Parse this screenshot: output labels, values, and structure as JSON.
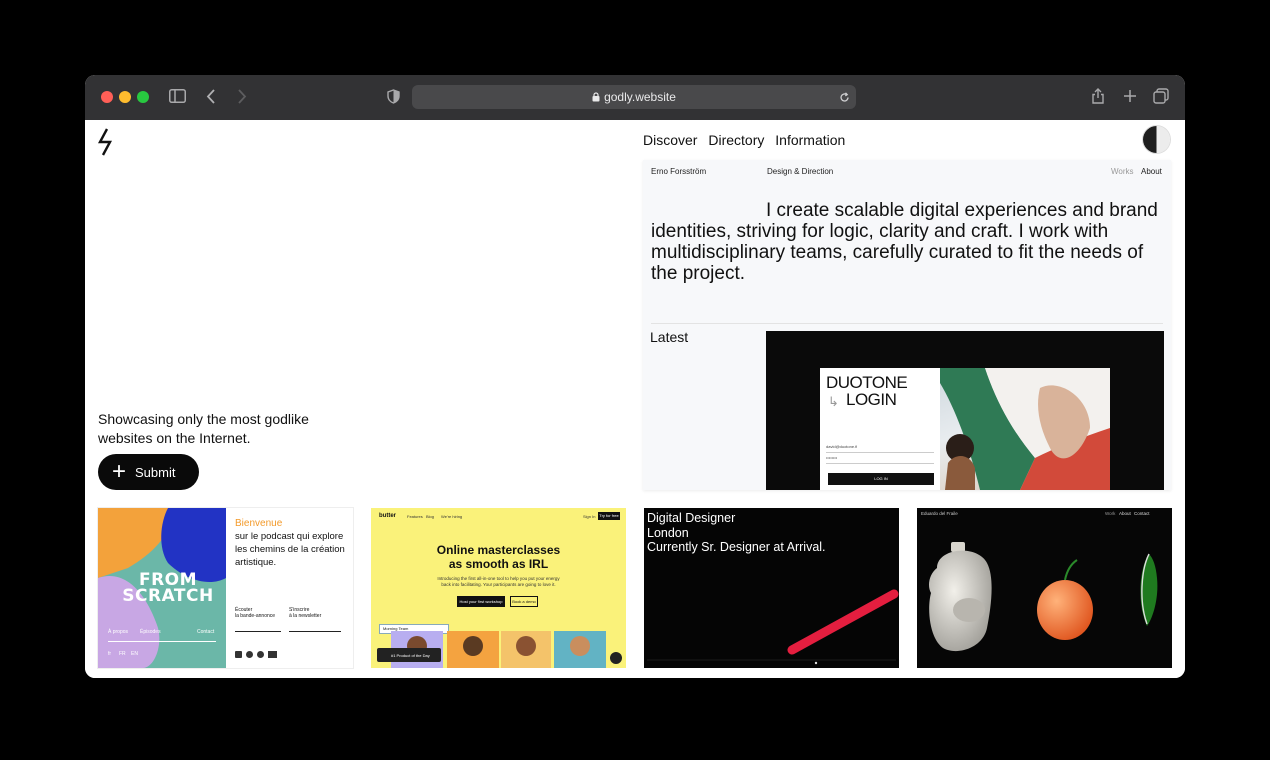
{
  "browser": {
    "url": "godly.website",
    "traffic_lights": [
      "#ff5f57",
      "#febc2e",
      "#28c840"
    ]
  },
  "site": {
    "nav": [
      "Discover",
      "Directory",
      "Information"
    ],
    "tagline": "Showcasing only the most godlike websites on the Internet.",
    "submit_label": "Submit"
  },
  "feature": {
    "name": "Erno Forsström",
    "role": "Design & Direction",
    "works": "Works",
    "about": "About",
    "intro": "I create scalable digital experiences and brand identities, striving for logic, clarity and craft. I work with multidisciplinary teams, carefully curated to fit the needs of the project.",
    "latest_label": "Latest",
    "shot": {
      "title_line1": "DUOTONE",
      "title_line2": "LOGIN",
      "email": "david@duotone.fi",
      "password": "••••••••",
      "button": "LOG IN"
    }
  },
  "thumbs": {
    "t1": {
      "art_line1": "FROM",
      "art_line2": "SCRATCH",
      "links": [
        "À propos",
        "Épisodes",
        "Contact"
      ],
      "langs": [
        "fr",
        "FR",
        "EN"
      ],
      "welcome": "Bienvenue",
      "body": "sur le podcast qui explore les chemins de la création artistique.",
      "listen": "Écouter",
      "listen_sub": "la bande-annonce",
      "signup": "S'inscrire",
      "signup_sub": "à la newsletter"
    },
    "t2": {
      "brand": "butter",
      "nav": [
        "Features",
        "Blog",
        "We're hiring"
      ],
      "signin": "Sign In",
      "cta_top": "Try for free",
      "headline1": "Online masterclasses",
      "headline2": "as smooth as IRL",
      "sub": "Introducing the first all-in-one tool to help you put your energy back into facilitating. Your participants are going to love it.",
      "btn_primary": "Host your first workshop",
      "btn_secondary": "Book a demo",
      "product_hunt": "#1 Product of the Day",
      "session_label": "Morning Team"
    },
    "t3": {
      "line1": "Digital Designer",
      "line2": "London",
      "line3": "Currently Sr. Designer at Arrival."
    },
    "t4": {
      "name": "Eduardo del Fraile",
      "nav": [
        "Work",
        "About",
        "Contact"
      ]
    }
  }
}
